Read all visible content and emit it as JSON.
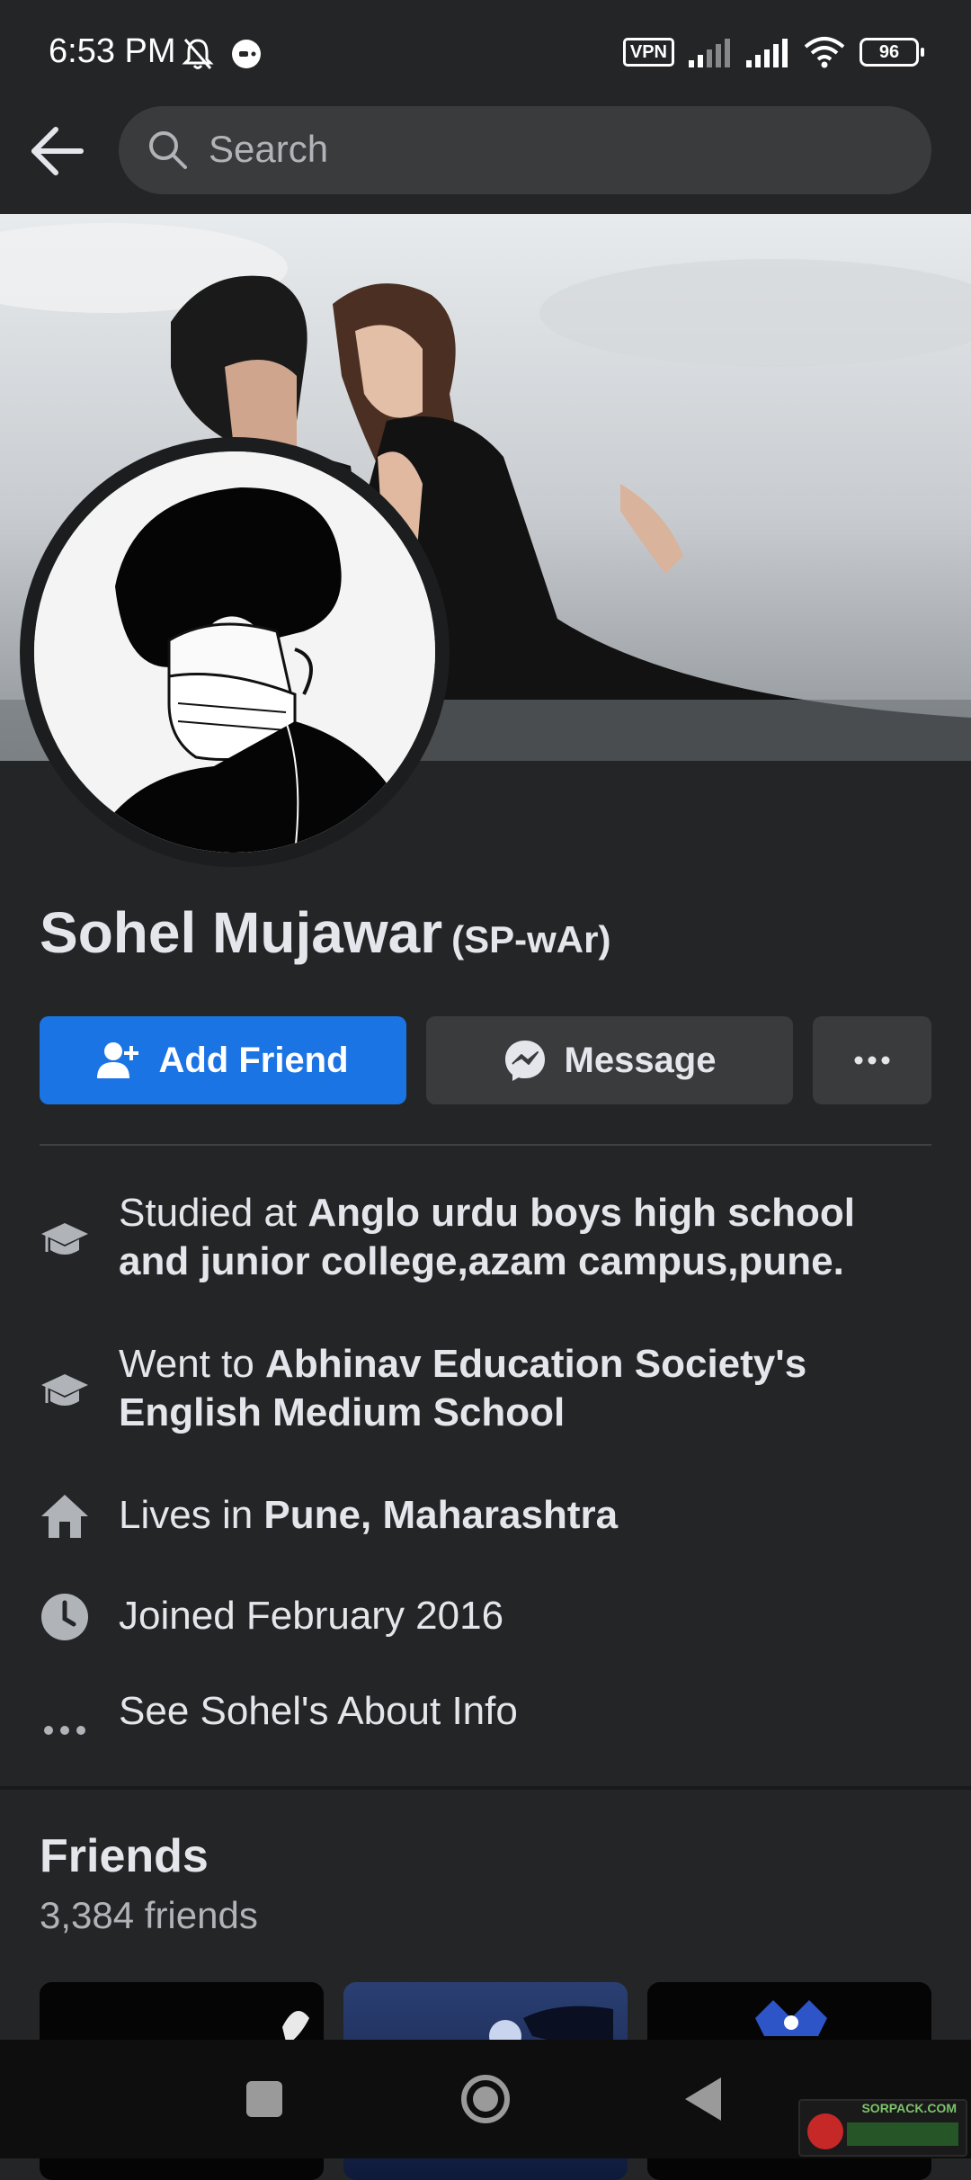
{
  "status_bar": {
    "time": "6:53 PM",
    "vpn": "VPN",
    "battery": "96"
  },
  "search": {
    "placeholder": "Search"
  },
  "profile": {
    "name": "Sohel Mujawar",
    "alternate_name": "(SP-wAr)"
  },
  "actions": {
    "add_friend": "Add Friend",
    "message": "Message"
  },
  "intro": {
    "studied_prefix": "Studied at ",
    "studied_at": "Anglo urdu boys high school and junior college,azam campus,pune.",
    "went_prefix": "Went to ",
    "went_to": "Abhinav Education Society's English Medium School",
    "lives_prefix": "Lives in ",
    "lives_in": "Pune, Maharashtra",
    "joined": "Joined February 2016",
    "about_link": "See Sohel's About Info"
  },
  "friends": {
    "title": "Friends",
    "count": "3,384 friends"
  },
  "watermark": "SORPACK.COM",
  "colors": {
    "background": "#242526",
    "primary_button": "#1b74e4",
    "secondary_button": "#3a3b3c",
    "muted_text": "#b0b3b8"
  },
  "icons": {
    "back": "arrow-left-icon",
    "search": "search-icon",
    "add_friend": "user-plus-icon",
    "message": "messenger-icon",
    "more": "ellipsis-icon",
    "education": "graduation-cap-icon",
    "home": "home-icon",
    "clock": "clock-icon"
  }
}
